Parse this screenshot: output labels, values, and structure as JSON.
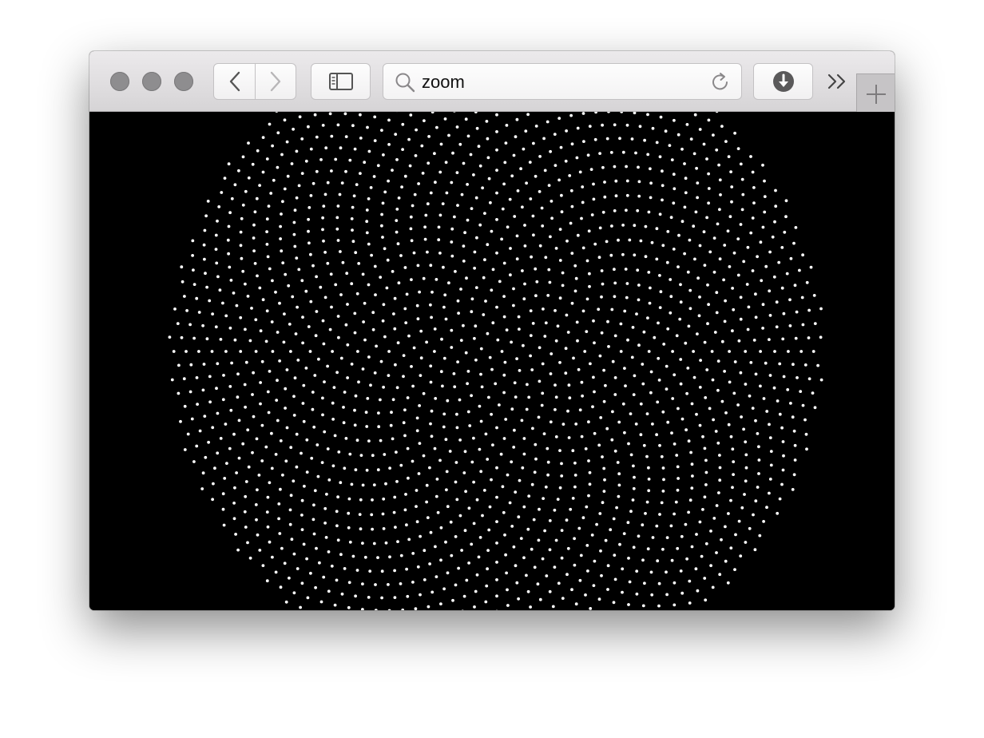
{
  "browser": {
    "search": {
      "query": "zoom"
    },
    "toolbar": {
      "traffic_lights": [
        "close",
        "minimize",
        "zoom"
      ],
      "back_icon": "chevron-left-icon",
      "forward_icon": "chevron-right-icon",
      "sidebar_icon": "sidebar-icon",
      "search_icon": "magnifier-icon",
      "reload_icon": "reload-icon",
      "downloads_icon": "download-icon",
      "overflow_icon": "double-chevron-right-icon",
      "newtab_icon": "plus-icon"
    },
    "colors": {
      "content_background": "#000000",
      "dot_color": "#ffffff",
      "traffic_light": "#8e8d8f"
    }
  },
  "canvas": {
    "pattern": "phyllotaxis",
    "dot_count": 2000,
    "divergence_angle_deg": 137.5
  }
}
